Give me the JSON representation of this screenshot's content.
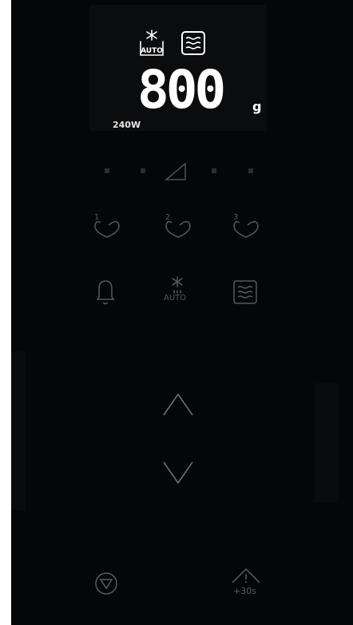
{
  "display": {
    "weight_value": "800",
    "weight_unit": "g",
    "power_level": "240W",
    "auto_badge_text": "AUTO"
  },
  "controls": {
    "memory_buttons": [
      "1",
      "2",
      "3"
    ],
    "auto_button_text": "AUTO",
    "time_add_label": "+30s"
  },
  "colors": {
    "panel_background": "#050608",
    "display_background": "#0b0c0e",
    "lit_segment": "#ffffff",
    "inactive_glyph": "#55595e"
  },
  "icons": {
    "display": [
      "auto-defrost-icon",
      "grill-icon"
    ],
    "level": [
      "level-ramp-icon"
    ],
    "memory": [
      "heart-icon"
    ],
    "row2": [
      "bell-icon",
      "auto-defrost-icon",
      "grill-icon"
    ],
    "arrows": [
      "chevron-up-icon",
      "chevron-down-icon"
    ],
    "bottom": [
      "stop-icon",
      "start-icon"
    ]
  }
}
